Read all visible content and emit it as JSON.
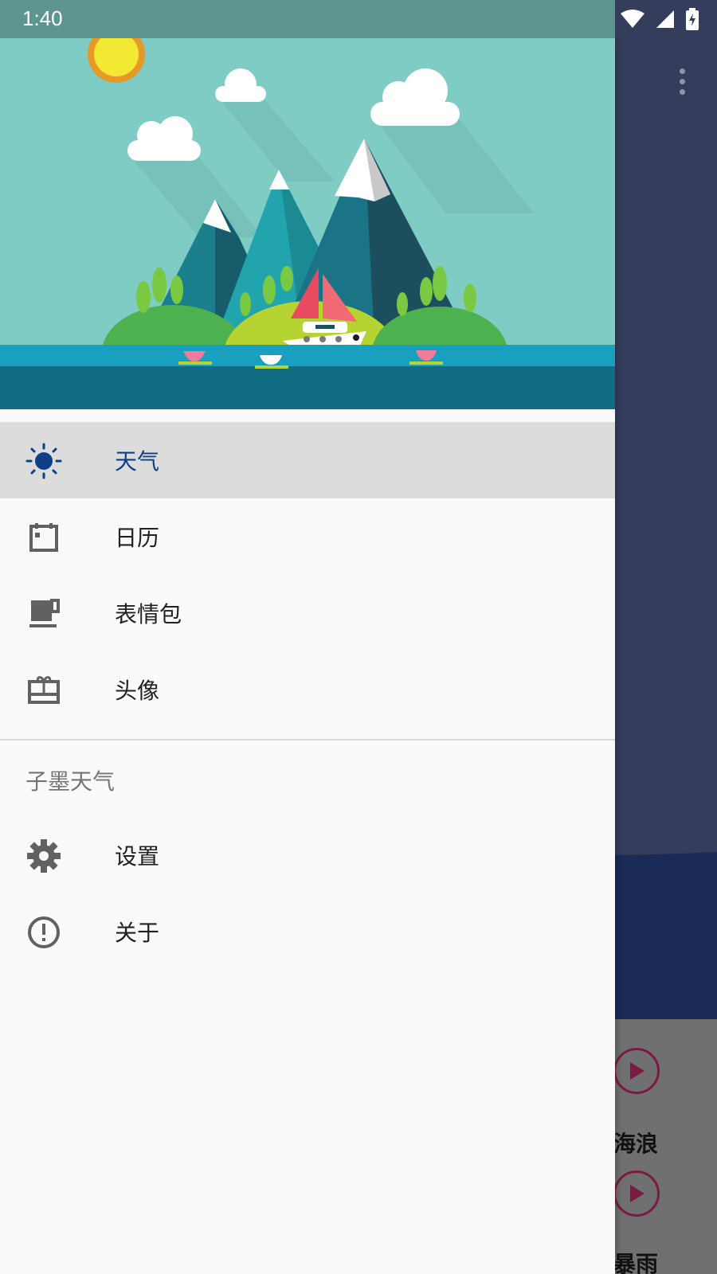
{
  "status_bar": {
    "time": "1:40"
  },
  "drawer": {
    "items": [
      {
        "label": "天气",
        "icon": "sun-icon",
        "selected": true
      },
      {
        "label": "日历",
        "icon": "calendar-icon",
        "selected": false
      },
      {
        "label": "表情包",
        "icon": "coffee-icon",
        "selected": false
      },
      {
        "label": "头像",
        "icon": "gift-card-icon",
        "selected": false
      }
    ],
    "section_title": "子墨天气",
    "section_items": [
      {
        "label": "设置",
        "icon": "gear-icon"
      },
      {
        "label": "关于",
        "icon": "info-icon"
      }
    ]
  },
  "background_app": {
    "sound_labels": [
      "海浪",
      "暴雨"
    ]
  },
  "colors": {
    "accent": "#0e3f86",
    "header_sky": "#7fccc4",
    "selected_bg": "#dcdcdc"
  }
}
